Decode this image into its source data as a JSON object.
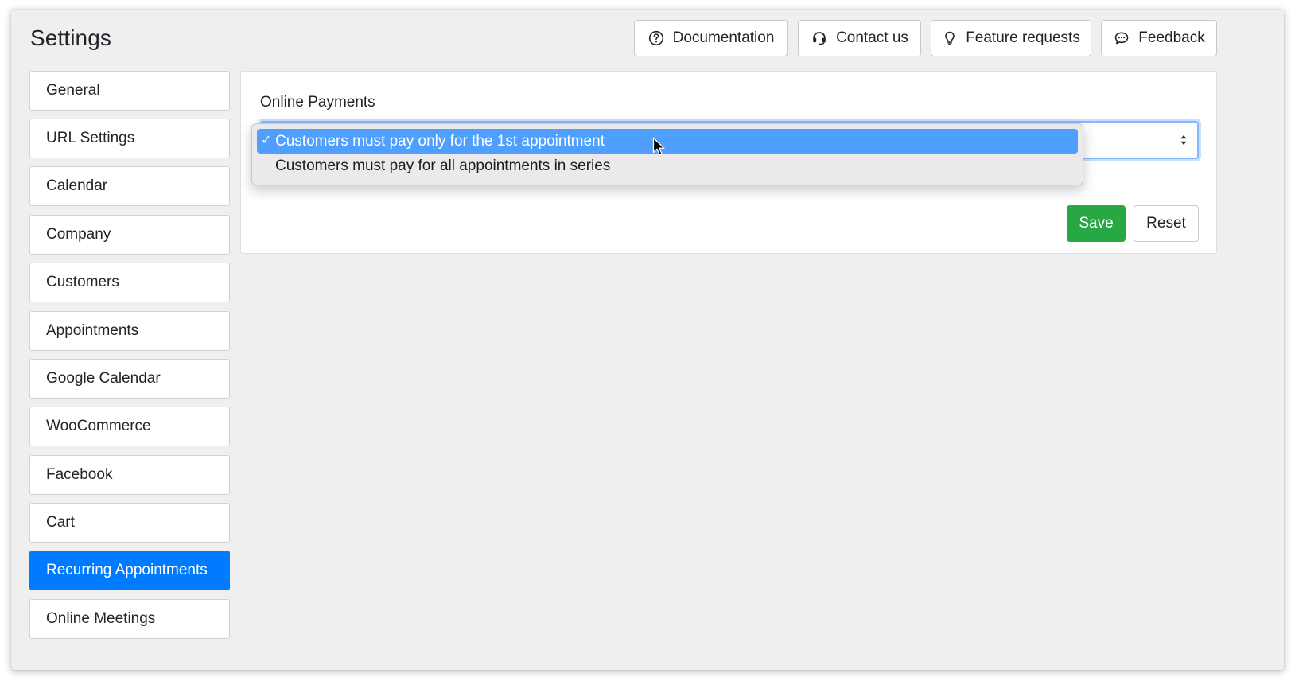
{
  "header": {
    "title": "Settings",
    "buttons": [
      {
        "label": "Documentation",
        "icon": "question-circle-icon"
      },
      {
        "label": "Contact us",
        "icon": "headset-icon"
      },
      {
        "label": "Feature requests",
        "icon": "lightbulb-icon"
      },
      {
        "label": "Feedback",
        "icon": "chat-bubble-icon"
      }
    ]
  },
  "sidebar": {
    "items": [
      {
        "label": "General"
      },
      {
        "label": "URL Settings"
      },
      {
        "label": "Calendar"
      },
      {
        "label": "Company"
      },
      {
        "label": "Customers"
      },
      {
        "label": "Appointments"
      },
      {
        "label": "Google Calendar"
      },
      {
        "label": "WooCommerce"
      },
      {
        "label": "Facebook"
      },
      {
        "label": "Cart"
      },
      {
        "label": "Recurring Appointments",
        "active": true
      },
      {
        "label": "Online Meetings"
      }
    ]
  },
  "main": {
    "field_label": "Online Payments",
    "select": {
      "selected_index": 0,
      "options": [
        "Customers must pay only for the 1st appointment",
        "Customers must pay for all appointments in series"
      ],
      "check_mark": "✓"
    },
    "save_label": "Save",
    "reset_label": "Reset"
  },
  "colors": {
    "accent": "#007bff",
    "save_green": "#28a745",
    "dropdown_highlight": "#4f9ffe"
  }
}
